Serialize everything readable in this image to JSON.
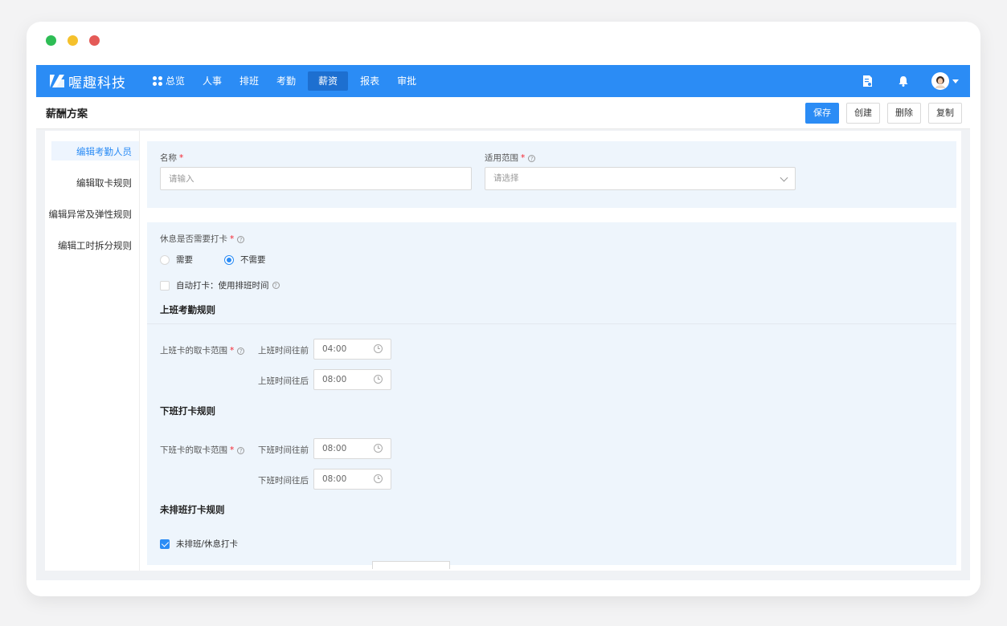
{
  "brand": {
    "name": "喔趣科技"
  },
  "nav": [
    {
      "label": "总览",
      "icon": "grid-icon",
      "active": false
    },
    {
      "label": "人事",
      "active": false
    },
    {
      "label": "排班",
      "active": false
    },
    {
      "label": "考勤",
      "active": false
    },
    {
      "label": "薪资",
      "active": true
    },
    {
      "label": "报表",
      "active": false
    },
    {
      "label": "审批",
      "active": false
    }
  ],
  "header": {
    "title": "薪酬方案",
    "actions": {
      "save": "保存",
      "create": "创建",
      "delete": "删除",
      "copy": "复制"
    }
  },
  "sidenav": [
    {
      "label": "编辑考勤人员",
      "active": true
    },
    {
      "label": "编辑取卡规则",
      "active": false
    },
    {
      "label": "编辑异常及弹性规则",
      "active": false
    },
    {
      "label": "编辑工时拆分规则",
      "active": false
    }
  ],
  "form": {
    "name": {
      "label": "名称",
      "placeholder": "请输入",
      "value": ""
    },
    "scope": {
      "label": "适用范围",
      "placeholder": "请选择"
    },
    "rest_punch": {
      "label": "休息是否需要打卡",
      "options": [
        "需要",
        "不需要"
      ],
      "selected": "不需要"
    },
    "auto_punch": {
      "label": "自动打卡：使用排班时间",
      "checked": false
    },
    "on_duty": {
      "title": "上班考勤规则",
      "range_label": "上班卡的取卡范围",
      "before_label": "上班时间往前",
      "before_value": "04:00",
      "after_label": "上班时间往后",
      "after_value": "08:00"
    },
    "off_duty": {
      "title": "下班打卡规则",
      "range_label": "下班卡的取卡范围",
      "before_label": "下班时间往前",
      "before_value": "08:00",
      "after_label": "下班时间往后",
      "after_value": "08:00"
    },
    "unscheduled": {
      "title": "未排班打卡规则",
      "checkbox_label": "未排班/休息打卡",
      "checked": true
    }
  },
  "colors": {
    "primary": "#2b8cf5",
    "nav_active": "#1d6fd0",
    "panel_bg": "#eef5fc",
    "required": "#f5222d"
  }
}
